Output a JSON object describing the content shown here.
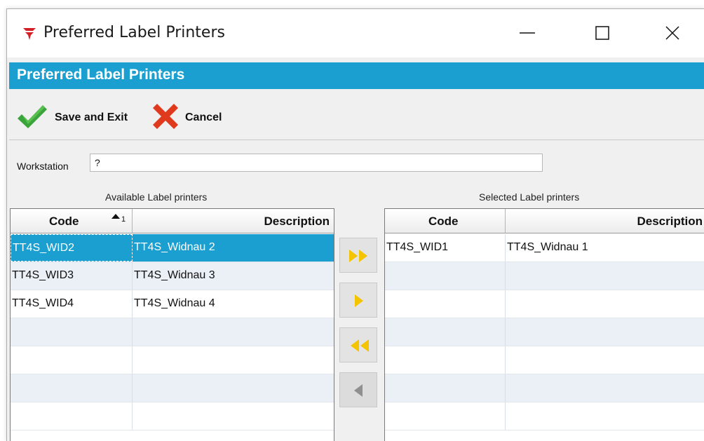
{
  "window": {
    "title": "Preferred Label Printers"
  },
  "header": {
    "title": "Preferred Label Printers"
  },
  "toolbar": {
    "save_label": "Save and Exit",
    "cancel_label": "Cancel"
  },
  "workstation": {
    "label": "Workstation",
    "value": "?"
  },
  "available": {
    "caption": "Available Label printers",
    "columns": {
      "code": "Code",
      "description": "Description"
    },
    "sort_indicator": "1",
    "rows": [
      {
        "code": "TT4S_WID2",
        "description": "TT4S_Widnau 2"
      },
      {
        "code": "TT4S_WID3",
        "description": "TT4S_Widnau 3"
      },
      {
        "code": "TT4S_WID4",
        "description": "TT4S_Widnau 4"
      },
      {
        "code": "",
        "description": ""
      },
      {
        "code": "",
        "description": ""
      },
      {
        "code": "",
        "description": ""
      },
      {
        "code": "",
        "description": ""
      }
    ]
  },
  "selected": {
    "caption": "Selected Label printers",
    "columns": {
      "code": "Code",
      "description": "Description"
    },
    "rows": [
      {
        "code": "TT4S_WID1",
        "description": "TT4S_Widnau 1"
      },
      {
        "code": "",
        "description": ""
      },
      {
        "code": "",
        "description": ""
      },
      {
        "code": "",
        "description": ""
      },
      {
        "code": "",
        "description": ""
      },
      {
        "code": "",
        "description": ""
      },
      {
        "code": "",
        "description": ""
      }
    ]
  },
  "transfer_buttons": [
    {
      "name": "move-all-right",
      "icon": "double-arrow-right-icon"
    },
    {
      "name": "move-one-right",
      "icon": "arrow-right-icon"
    },
    {
      "name": "move-all-left",
      "icon": "double-arrow-left-icon"
    },
    {
      "name": "move-one-left",
      "icon": "arrow-left-icon"
    }
  ],
  "colors": {
    "accent": "#1a9fd0",
    "arrow": "#f5c400",
    "check": "#3aa33a",
    "cancel": "#e03a1e"
  }
}
